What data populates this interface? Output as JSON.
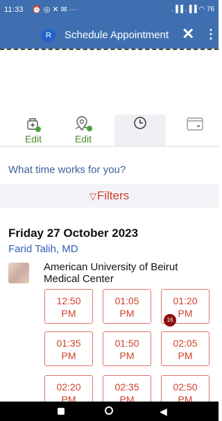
{
  "status_bar": {
    "time": "11:33",
    "status_icons": "⏰ ◎ ✕ ✉ ···",
    "system_icons": ".▐▐ .▐▐ ◠ 76"
  },
  "app_bar": {
    "avatar_letter": "R",
    "title": "Schedule Appointment",
    "close_glyph": "✕",
    "menu_glyph": "⋮"
  },
  "tabs": [
    {
      "label": "Edit",
      "icon": "hospital-check-icon"
    },
    {
      "label": "Edit",
      "icon": "location-check-icon"
    },
    {
      "label": "",
      "icon": "clock-icon",
      "active": true
    },
    {
      "label": "",
      "icon": "calendar-icon"
    }
  ],
  "question": "What time works for you?",
  "filters_label": "Filters",
  "filter_icon_glyph": "▽",
  "appointment": {
    "date": "Friday 27 October 2023",
    "doctor": "Farid Talih, MD",
    "hospital_line1": "American University of Beirut",
    "hospital_line2": "Medical Center"
  },
  "slots": [
    {
      "time": "12:50",
      "ampm": "PM"
    },
    {
      "time": "01:05",
      "ampm": "PM"
    },
    {
      "time": "01:20",
      "ampm": "PM"
    },
    {
      "time": "01:35",
      "ampm": "PM"
    },
    {
      "time": "01:50",
      "ampm": "PM"
    },
    {
      "time": "02:05",
      "ampm": "PM"
    },
    {
      "time": "02:20",
      "ampm": "PM"
    },
    {
      "time": "02:35",
      "ampm": "PM"
    },
    {
      "time": "02:50",
      "ampm": "PM"
    }
  ],
  "badge_count": "16",
  "colors": {
    "app_bar": "#3f6fb1",
    "accent_red": "#d0402b",
    "link_blue": "#2e5fb8",
    "check_green": "#46a436"
  }
}
